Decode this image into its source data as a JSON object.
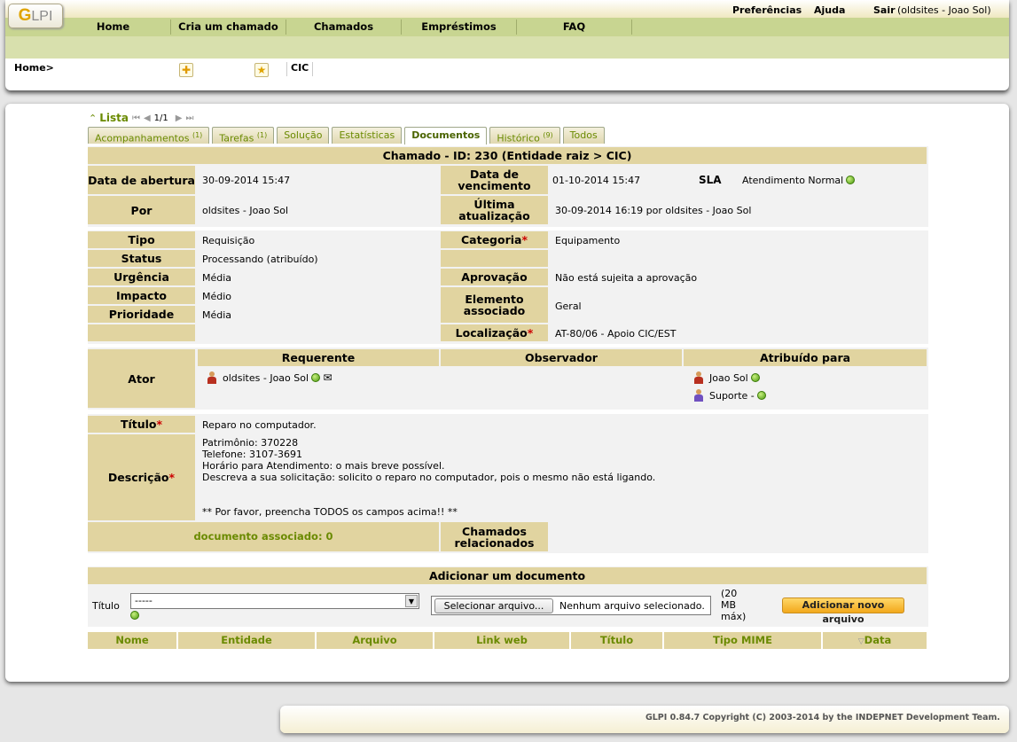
{
  "app": {
    "logo_text": "LPI",
    "logo_letter": "G"
  },
  "top_links": {
    "preferences": "Preferências",
    "help": "Ajuda",
    "logout": "Sair",
    "user": "(oldsites - Joao Sol)"
  },
  "menu": [
    "Home",
    "Cria um chamado",
    "Chamados",
    "Empréstimos",
    "FAQ"
  ],
  "breadcrumb": {
    "home": "Home>",
    "entity": "CIC"
  },
  "list_nav": {
    "label": "Lista",
    "position": "1/1"
  },
  "tabs": [
    {
      "label": "Acompanhamentos",
      "count": "(1)"
    },
    {
      "label": "Tarefas",
      "count": "(1)"
    },
    {
      "label": "Solução",
      "count": ""
    },
    {
      "label": "Estatísticas",
      "count": ""
    },
    {
      "label": "Documentos",
      "count": ""
    },
    {
      "label": "Histórico",
      "count": "(9)"
    },
    {
      "label": "Todos",
      "count": ""
    }
  ],
  "ticket": {
    "header": "Chamado - ID: 230 (Entidade raiz > CIC)",
    "open_date_label": "Data de abertura",
    "open_date": "30-09-2014 15:47",
    "due_date_label": "Data de vencimento",
    "due_date": "01-10-2014 15:47",
    "sla_label": "SLA",
    "sla": "Atendimento Normal",
    "by_label": "Por",
    "by": "oldsites - Joao Sol",
    "last_update_label": "Última atualização",
    "last_update": "30-09-2014 16:19 por oldsites - Joao Sol",
    "type_label": "Tipo",
    "type": "Requisição",
    "category_label": "Categoria",
    "category": "Equipamento",
    "status_label": "Status",
    "status": "Processando (atribuído)",
    "urgency_label": "Urgência",
    "urgency": "Média",
    "approval_label": "Aprovação",
    "approval": "Não está sujeita a aprovação",
    "impact_label": "Impacto",
    "impact": "Médio",
    "element_label": "Elemento associado",
    "element": "Geral",
    "priority_label": "Prioridade",
    "priority": "Média",
    "location_label": "Localização",
    "location": "AT-80/06 - Apoio CIC/EST",
    "actor_label": "Ator",
    "requester_label": "Requerente",
    "observer_label": "Observador",
    "assigned_label": "Atribuído para",
    "requester": "oldsites - Joao Sol",
    "assigned_user": "Joao Sol",
    "assigned_group": "Suporte -",
    "title_label": "Título",
    "title": "Reparo no computador.",
    "description_label": "Descrição",
    "description_lines": [
      "Patrimônio: 370228",
      "Telefone: 3107-3691",
      "Horário para Atendimento: o mais breve possível.",
      "Descreva a sua solicitação: solicito o reparo no computador, pois o mesmo não está ligando.",
      "",
      "",
      "** Por favor, preencha TODOS os campos acima!! **"
    ],
    "docs_linked": "documento associado: 0",
    "related_label": "Chamados relacionados"
  },
  "add_doc": {
    "header": "Adicionar um documento",
    "title_label": "Título",
    "select_value": "-----",
    "file_button": "Selecionar arquivo...",
    "file_status": "Nenhum arquivo selecionado.",
    "max_size": "(20 MB máx)",
    "submit": "Adicionar novo arquivo"
  },
  "doc_columns": [
    "Nome",
    "Entidade",
    "Arquivo",
    "Link web",
    "Título",
    "Tipo MIME",
    "Data"
  ],
  "footer": "GLPI 0.84.7 Copyright (C) 2003-2014 by the INDEPNET Development Team."
}
